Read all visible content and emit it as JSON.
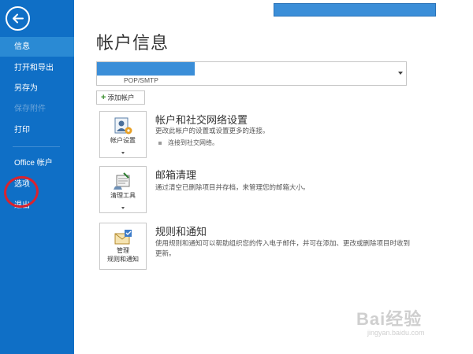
{
  "sidebar": {
    "back_icon": "arrow-left-icon",
    "items": [
      {
        "label": "信息",
        "active": true
      },
      {
        "label": "打开和导出"
      },
      {
        "label": "另存为"
      },
      {
        "label": "保存附件",
        "disabled": true
      },
      {
        "label": "打印"
      },
      {
        "label": "Office 帐户"
      },
      {
        "label": "选项"
      },
      {
        "label": "退出"
      }
    ]
  },
  "main": {
    "title": "帐户信息",
    "account_select": {
      "type": "POP/SMTP"
    },
    "add_account_label": "添加帐户",
    "sections": [
      {
        "tile_label": "帐户设置",
        "tile_icon": "account-settings-icon",
        "title": "帐户和社交网络设置",
        "description": "更改此帐户的设置或设置更多的连接。",
        "bullet": "连接到社交网络。"
      },
      {
        "tile_label": "清理工具",
        "tile_icon": "cleanup-tools-icon",
        "title": "邮箱清理",
        "description": "通过清空已删除项目并存档，来管理您的邮箱大小。"
      },
      {
        "tile_label_line1": "管理",
        "tile_label_line2": "规则和通知",
        "tile_icon": "rules-alerts-icon",
        "title": "规则和通知",
        "description": "使用规则和通知可以帮助组织您的传入电子邮件，并可在添加、更改或删除项目时收到更新。"
      }
    ]
  },
  "watermark": {
    "logo": "Bai经验",
    "url": "jingyan.baidu.com"
  },
  "colors": {
    "sidebar": "#0f6fc6",
    "sidebar_active": "#2a8ad4",
    "highlight_circle": "#d9232e",
    "redaction": "#3b8ed8"
  }
}
